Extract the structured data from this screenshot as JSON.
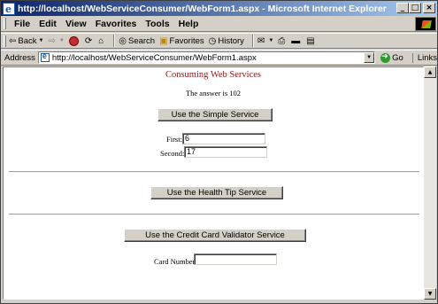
{
  "window": {
    "title": "http://localhost/WebServiceConsumer/WebForm1.aspx - Microsoft Internet Explorer"
  },
  "menu": [
    "File",
    "Edit",
    "View",
    "Favorites",
    "Tools",
    "Help"
  ],
  "toolbar": {
    "back": "Back",
    "search": "Search",
    "favorites": "Favorites",
    "history": "History"
  },
  "address": {
    "label": "Address",
    "url": "http://localhost/WebServiceConsumer/WebForm1.aspx",
    "go": "Go",
    "links": "Links"
  },
  "page": {
    "heading": "Consuming Web Services",
    "answer": "The answer is 102",
    "simple_button": "Use the Simple Service",
    "first_label": "First:",
    "first_value": "6",
    "second_label": "Second:",
    "second_value": "17",
    "health_button": "Use the Health Tip Service",
    "cc_button": "Use the Credit Card Validator Service",
    "card_label": "Card Number:",
    "card_value": ""
  }
}
